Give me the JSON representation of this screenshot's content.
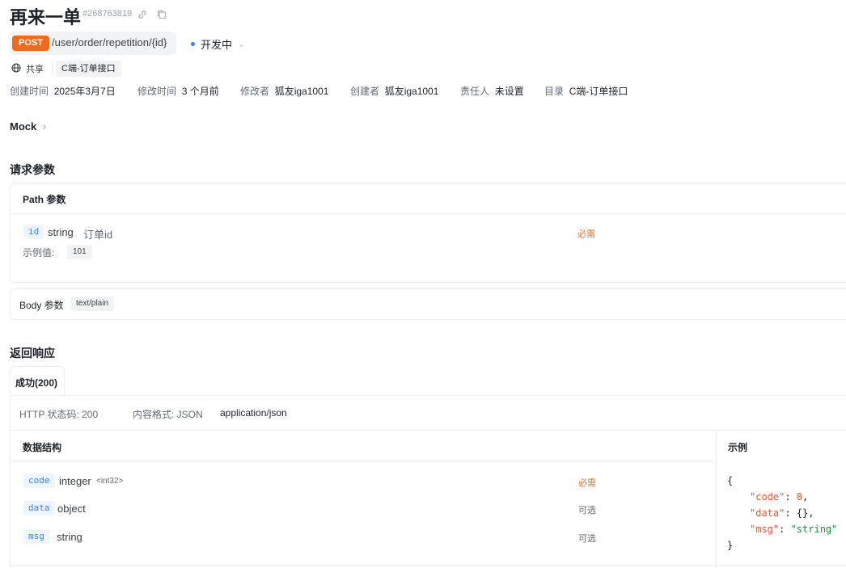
{
  "header": {
    "title": "再来一单",
    "doc_id": "#268763819"
  },
  "endpoint": {
    "method": "POST",
    "path": "/user/order/repetition/{id}",
    "status": "开发中"
  },
  "tags": {
    "share_label": "共享",
    "folder_tag": "C端-订单接口"
  },
  "meta": [
    {
      "key": "创建时间",
      "value": "2025年3月7日"
    },
    {
      "key": "修改时间",
      "value": "3 个月前"
    },
    {
      "key": "修改者",
      "value": "狐友iga1001"
    },
    {
      "key": "创建者",
      "value": "狐友iga1001"
    },
    {
      "key": "责任人",
      "value": "未设置"
    },
    {
      "key": "目录",
      "value": "C端-订单接口"
    }
  ],
  "mock": {
    "label": "Mock"
  },
  "request": {
    "title": "请求参数",
    "path_params": {
      "title": "Path 参数",
      "param": {
        "name": "id",
        "type": "string",
        "desc": "订单id",
        "required": "必需",
        "example_label": "示例值:",
        "example_value": "101"
      }
    },
    "body": {
      "title": "Body 参数",
      "content_type": "text/plain"
    }
  },
  "response": {
    "title": "返回响应",
    "tab": "成功(200)",
    "http_status": "HTTP 状态码: 200",
    "content_format": "内容格式: JSON",
    "mime": "application/json",
    "schema_title": "数据结构",
    "example_title": "示例",
    "fields": [
      {
        "name": "code",
        "type": "integer",
        "format": "<int32>",
        "required": "必需"
      },
      {
        "name": "data",
        "type": "object",
        "format": "",
        "required": "可选"
      },
      {
        "name": "msg",
        "type": "string",
        "format": "",
        "required": "可选"
      }
    ],
    "example": {
      "open": "{",
      "lines": [
        {
          "key": "\"code\"",
          "sep": ": ",
          "val": "0",
          "tail": ","
        },
        {
          "key": "\"data\"",
          "sep": ": ",
          "val": "{}",
          "tail": ","
        },
        {
          "key": "\"msg\"",
          "sep": ": ",
          "val": "\"string\"",
          "tail": ""
        }
      ],
      "close": "}"
    }
  }
}
